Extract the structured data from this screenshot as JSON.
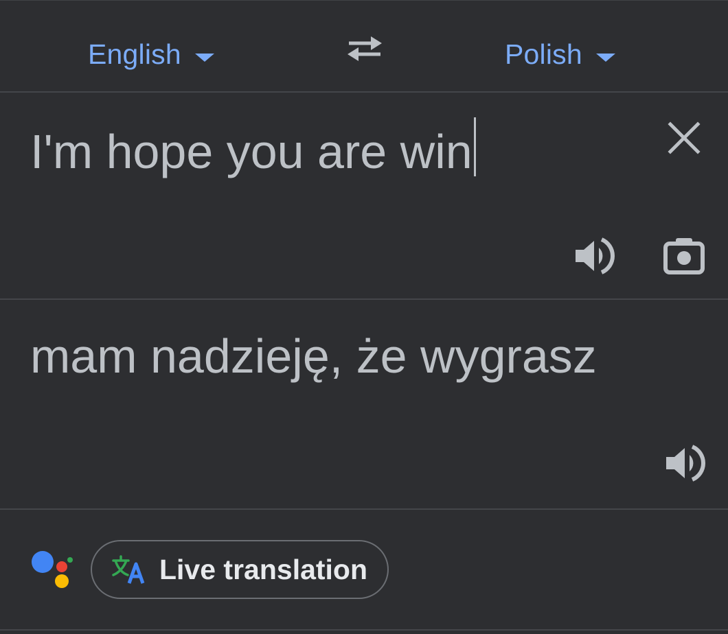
{
  "languages": {
    "source": "English",
    "target": "Polish"
  },
  "source": {
    "text": "I'm hope you are win"
  },
  "target": {
    "text": "mam nadzieję, że wygrasz"
  },
  "bottom": {
    "live_translation_label": "Live translation"
  },
  "icons": {
    "swap": "swap-languages-icon",
    "clear": "close-icon",
    "source_speak": "speaker-icon",
    "camera": "camera-icon",
    "target_speak": "speaker-icon",
    "assistant": "google-assistant-icon",
    "translate": "translate-icon"
  },
  "colors": {
    "background": "#2d2e31",
    "accent": "#7cacf8",
    "text": "#bdc1c6",
    "icon": "#bdc1c6"
  }
}
